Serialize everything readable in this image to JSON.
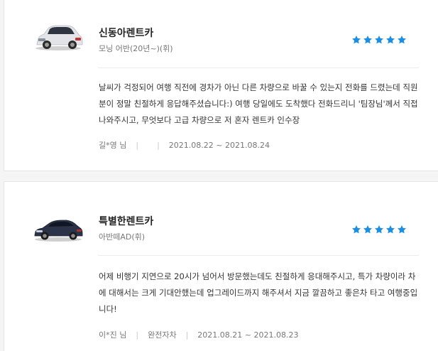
{
  "reviews": [
    {
      "shop_name": "신동아렌트카",
      "car_model": "모닝 어반(20년~)(휘)",
      "car_color": "#e8e8ea",
      "rating": 5,
      "review_text": "날씨가 걱정되어 여행 직전에 경차가 아닌 다른 차량으로 바꿀 수 있는지 전화를 드렸는데 직원분이 정말 친절하게 응답해주셨습니다:) 여행 당일에도 도착했다 전화드리니 '팀장님'께서 직접 나와주시고, 무엇보다 고급 차량으로 저 혼자 렌트카 인수장",
      "author": "길*영 님",
      "insurance": "",
      "sep": "|",
      "period": "2021.08.22 ~ 2021.08.24"
    },
    {
      "shop_name": "특별한렌트카",
      "car_model": "아반떼AD(휘)",
      "car_color": "#2a3347",
      "rating": 5,
      "review_text": "어제 비행기 지연으로 20시가 넘어서 방문했는데도 친절하게 응대해주시고, 특가 차량이라 차에 대해서는 크게 기대안했는데 업그레이드까지 해주셔서 지금 깔끔하고 좋은차 타고 여행중입니다!",
      "author": "이*진 님",
      "insurance": "완전자차",
      "sep": "|",
      "period": "2021.08.21 ~ 2021.08.23"
    }
  ],
  "colors": {
    "star": "#1a8fe3",
    "text_primary": "#222222",
    "text_secondary": "#777777"
  },
  "icons": {
    "rating": "star-icon",
    "car": "car-thumbnail-icon"
  }
}
